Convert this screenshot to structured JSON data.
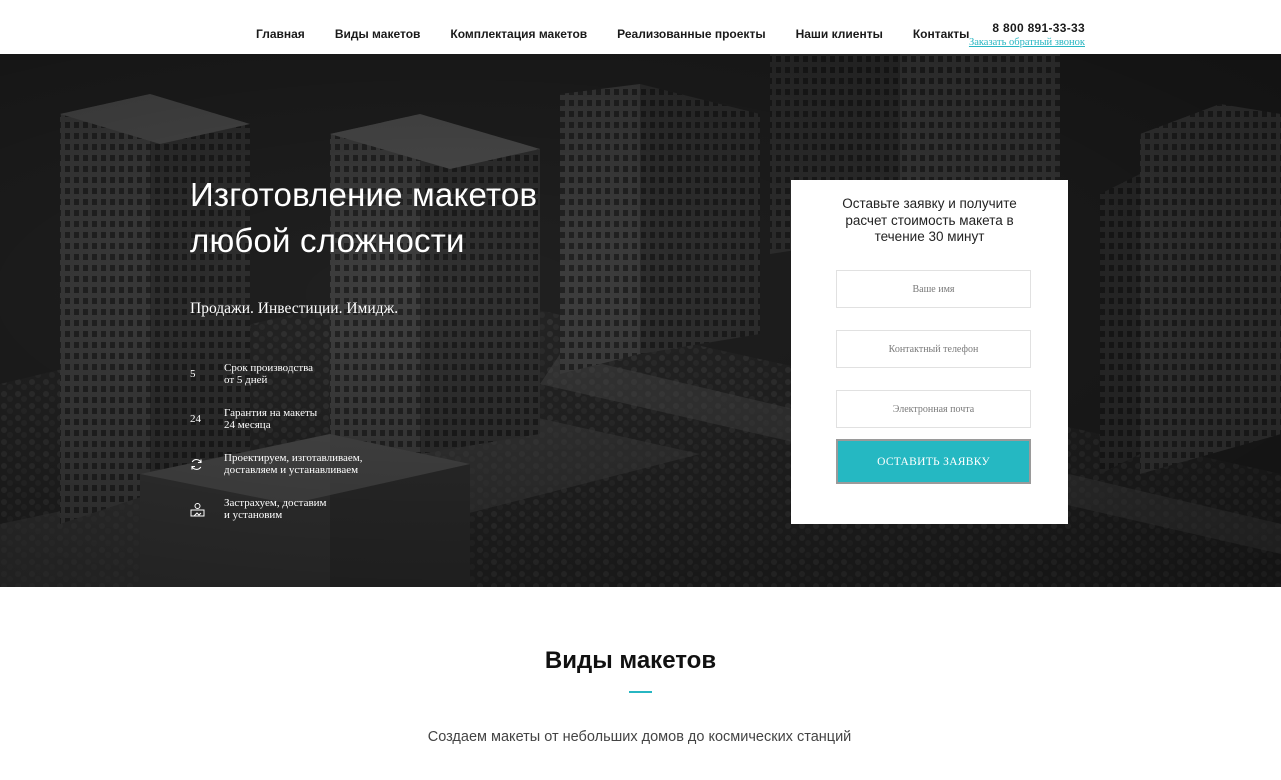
{
  "nav": {
    "items": [
      "Главная",
      "Виды макетов",
      "Комплектация макетов",
      "Реализованные проекты",
      "Наши клиенты",
      "Контакты"
    ]
  },
  "contact": {
    "phone": "8 800 891-33-33",
    "callback": "Заказать обратный звонок"
  },
  "hero": {
    "title_line1": "Изготовление макетов",
    "title_line2": "любой сложности",
    "subtitle": "Продажи. Инвестиции. Имидж.",
    "features": [
      {
        "icon": "5",
        "line1": "Срок производства",
        "line2": "от 5 дней"
      },
      {
        "icon": "24",
        "line1": "Гарантия на макеты",
        "line2": "24 месяца"
      },
      {
        "icon": "refresh-icon",
        "line1": "Проектируем, изготавливаем,",
        "line2": "доставляем и устанавливаем"
      },
      {
        "icon": "insurance-icon",
        "line1": "Застрахуем, доставим",
        "line2": "и установим"
      }
    ]
  },
  "form": {
    "title": "Оставьте заявку и получите расчет стоимость макета в течение 30 минут",
    "name_placeholder": "Ваше имя",
    "phone_placeholder": "Контактный телефон",
    "email_placeholder": "Электронная почта",
    "submit": "ОСТАВИТЬ ЗАЯВКУ"
  },
  "section": {
    "title": "Виды макетов",
    "subtitle": "Создаем макеты от небольших домов до космических станций"
  },
  "colors": {
    "accent": "#25b8c2",
    "hero_bg": "#1c1c1c",
    "text_dark": "#1a1a1a"
  }
}
